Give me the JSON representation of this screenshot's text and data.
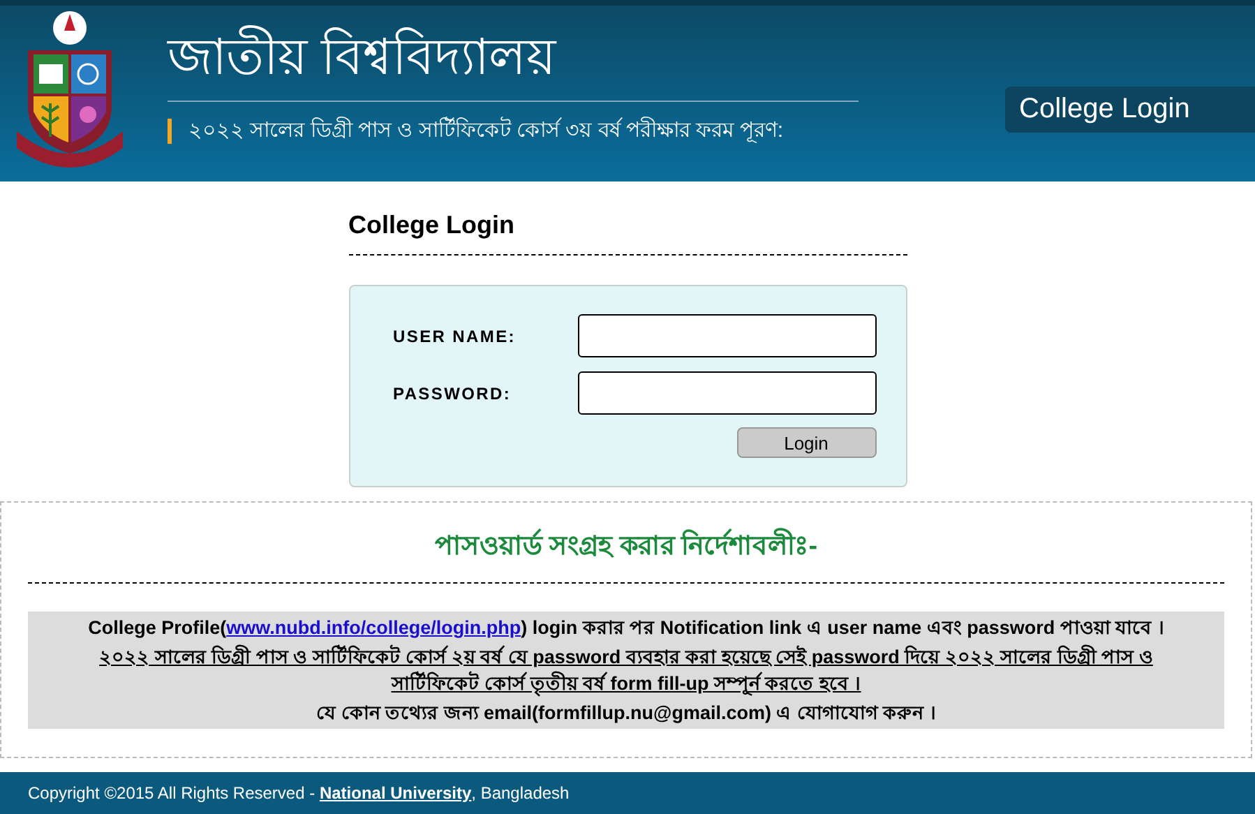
{
  "header": {
    "title": "জাতীয় বিশ্ববিদ্যালয়",
    "subtitle": "২০২২ সালের ডিগ্রী পাস ও সার্টিফিকেট কোর্স ৩য় বর্ষ পরীক্ষার ফরম পূরণ:",
    "nav_tab": "College Login"
  },
  "login": {
    "heading": "College Login",
    "fields": [
      {
        "label": "USER NAME:"
      },
      {
        "label": "PASSWORD:"
      }
    ],
    "button": "Login"
  },
  "instructions": {
    "heading": "পাসওয়ার্ড সংগ্রহ করার নির্দেশাবলীঃ-",
    "lines": [
      {
        "before": "College Profile(",
        "link": "www.nubd.info/college/login.php",
        "after": ") login করার পর Notification link এ user name এবং password পাওয়া যাবে ।",
        "underlined": false
      },
      {
        "text": "২০২২ সালের ডিগ্রী পাস ও সার্টিফিকেট কোর্স ২য় বর্ষ যে password ব্যবহার করা হয়েছে সেই password দিয়ে ২০২২ সালের ডিগ্রী পাস ও সার্টিফিকেট কোর্স তৃতীয় বর্ষ form fill-up সম্পূর্ন করতে হবে ।",
        "underlined": true
      },
      {
        "text": "যে কোন তথ্যের জন্য email(formfillup.nu@gmail.com) এ যোগাযোগ করুন ।",
        "underlined": false
      }
    ]
  },
  "footer": {
    "before": "Copyright ©2015 All Rights Reserved - ",
    "link": "National University",
    "after": ", Bangladesh"
  }
}
